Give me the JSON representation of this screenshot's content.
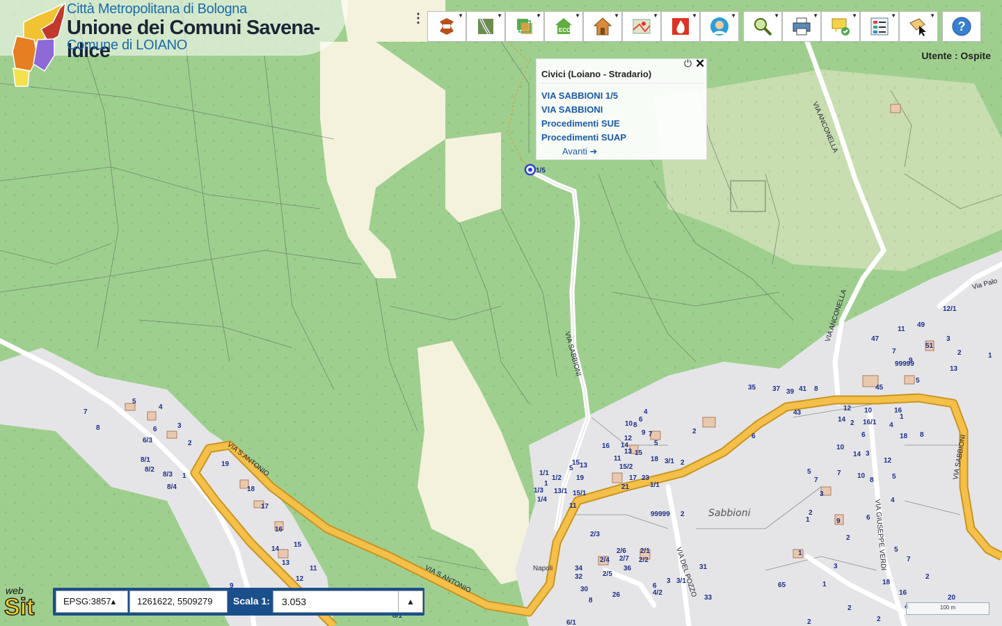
{
  "header": {
    "line1": "Città Metropolitana di Bologna",
    "line2": "Unione dei Comuni Savena-Idice",
    "line3": "Comune di LOIANO"
  },
  "toolbar": {
    "buttons": [
      {
        "icon": "layers-reload-icon"
      },
      {
        "icon": "road-map-icon"
      },
      {
        "icon": "cadastre-layers-icon"
      },
      {
        "icon": "eco-icon"
      },
      {
        "icon": "house-icon"
      },
      {
        "icon": "map-pin-icon"
      },
      {
        "icon": "fire-icon"
      },
      {
        "icon": "user-avatar-icon"
      },
      {
        "icon": "search-magnifier-icon"
      },
      {
        "icon": "printer-icon"
      },
      {
        "icon": "message-check-icon"
      },
      {
        "icon": "list-settings-icon"
      },
      {
        "icon": "select-cursor-icon"
      },
      {
        "icon": "help-icon"
      }
    ],
    "help_label": "?"
  },
  "user": {
    "label": "Utente : Ospite"
  },
  "popup": {
    "title": "Civici (Loiano - Stradario)",
    "links": [
      "VIA SABBIONI 1/5",
      "VIA SABBIONI",
      "Procedimenti SUE",
      "Procedimenti SUAP"
    ],
    "next": "Avanti ➔"
  },
  "status": {
    "epsg": "EPSG:3857▴",
    "coords": "1261622, 5509279",
    "scale_label": "Scala 1:",
    "scale_value": "3.053",
    "scale_btn": "▲"
  },
  "brand": {
    "web": "web",
    "sit": "Sit"
  },
  "scalebar": "100 m",
  "map": {
    "roads": [
      "VIA SABBIONI",
      "VIA ANCONELLA",
      "VIA S.ANTONIO",
      "VIA S.ANTONIO",
      "VIA DEL POZZO",
      "VIA GIUSEPPE VERDI",
      "VIA SABBIONI",
      "VIA ANCONELLA",
      "Via Palo"
    ],
    "place": "Sabbioni",
    "place2": "Napoli",
    "colors": {
      "wood": "#9fcf8f",
      "open": "#f4f2dc",
      "urban": "#e5e5e8",
      "main_road": "#f5c04a",
      "marker": "#2a3fd0"
    },
    "house_numbers": [
      "5",
      "4",
      "7",
      "8",
      "6",
      "6/3",
      "3",
      "2",
      "8/1",
      "8/2",
      "8/3",
      "8/4",
      "1",
      "19",
      "18",
      "17",
      "16",
      "15",
      "14",
      "13",
      "12",
      "11",
      "9",
      "8/1",
      "1/5",
      "2",
      "4",
      "6",
      "10",
      "8",
      "9",
      "7",
      "5",
      "16",
      "14",
      "12",
      "13",
      "15",
      "11",
      "15/2",
      "18",
      "1/1",
      "1/2",
      "1",
      "1/3",
      "1/4",
      "13/1",
      "15",
      "15/1",
      "11",
      "5",
      "13",
      "19",
      "17",
      "21",
      "23",
      "1/1",
      "3/1",
      "2",
      "6",
      "99999",
      "2",
      "2/3",
      "2/6",
      "2/1",
      "2/4",
      "2/7",
      "2/2",
      "2/5",
      "36",
      "34",
      "32",
      "30",
      "8",
      "26",
      "6/1",
      "6",
      "4/2",
      "3",
      "3/1",
      "31",
      "33",
      "35",
      "37",
      "39",
      "41",
      "8",
      "43",
      "45",
      "47",
      "11",
      "49",
      "99999",
      "7",
      "9",
      "51",
      "5",
      "3",
      "2",
      "1",
      "13",
      "12/1",
      "12",
      "10",
      "14",
      "2",
      "16/1",
      "16",
      "1",
      "4",
      "6",
      "3",
      "18",
      "8",
      "10",
      "14",
      "12",
      "5",
      "7",
      "10",
      "8",
      "4",
      "5",
      "7",
      "3",
      "2",
      "1",
      "9",
      "6",
      "2",
      "1",
      "3",
      "1",
      "5",
      "7",
      "2",
      "20",
      "18",
      "16",
      "4",
      "65",
      "2",
      "2",
      "2"
    ]
  }
}
